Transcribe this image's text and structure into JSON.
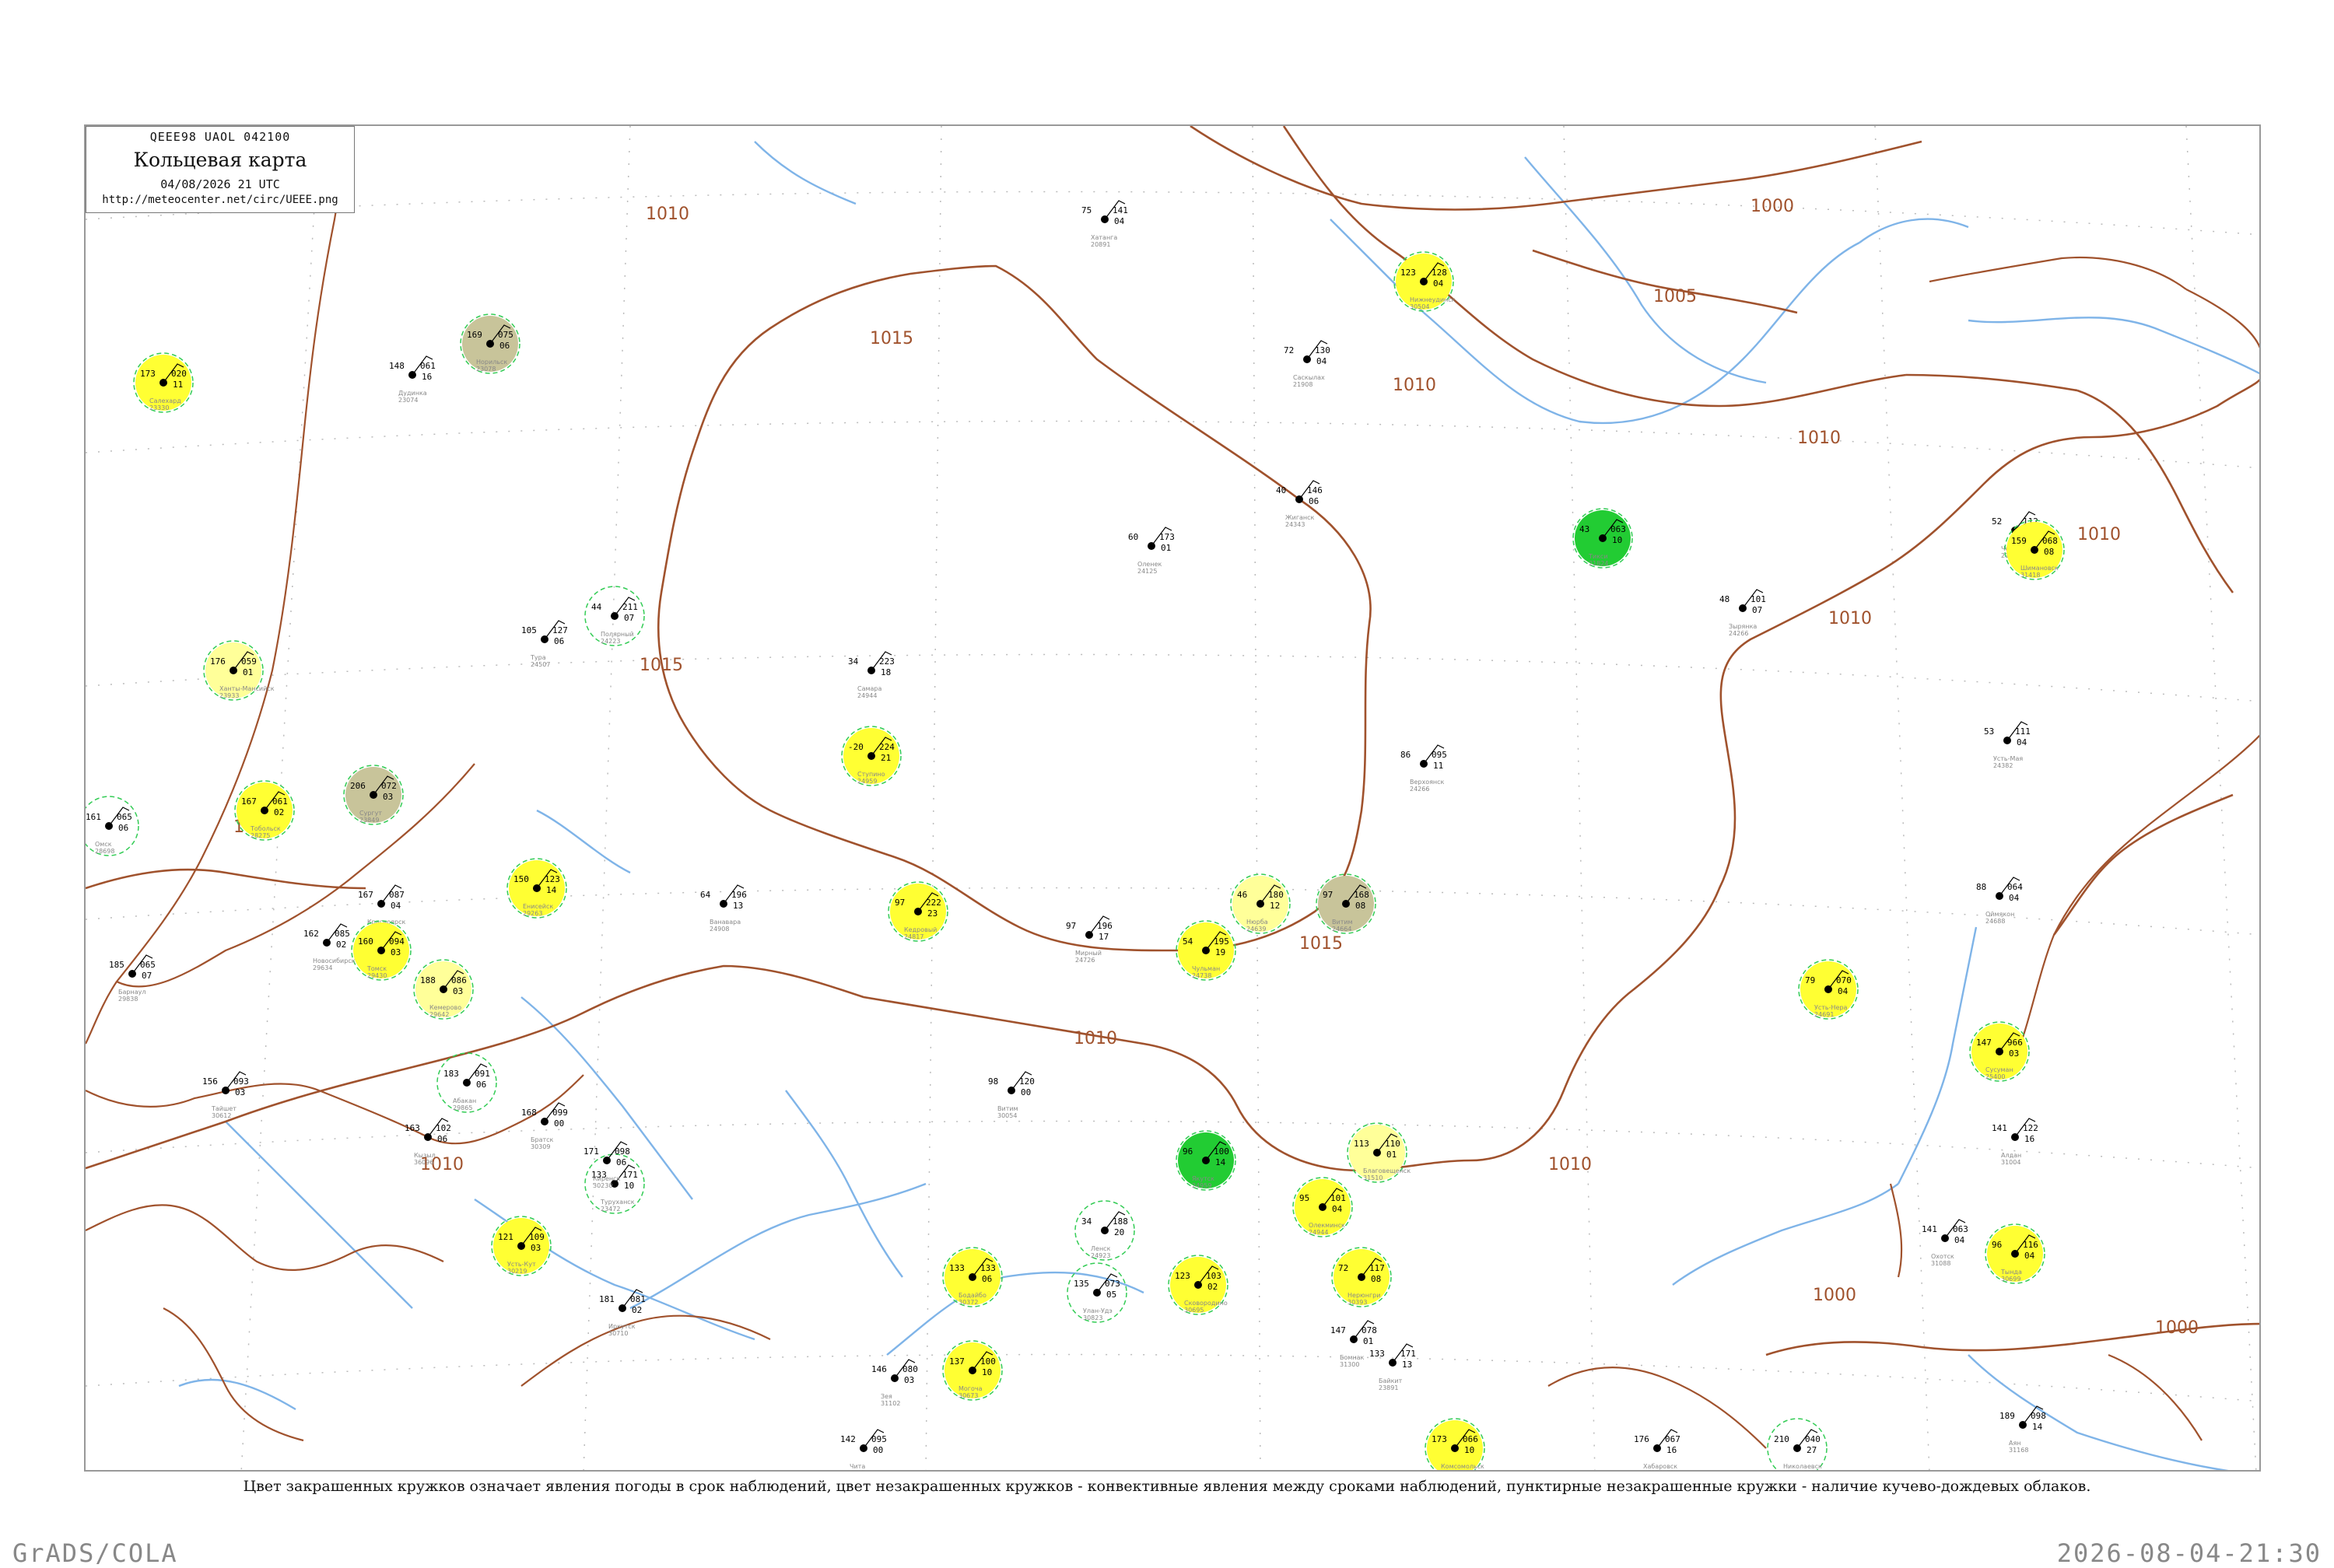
{
  "header": {
    "code": "QEEE98  UAOL  042100",
    "title": "Кольцевая карта",
    "date": "04/08/2026 21 UTC",
    "url": "http://meteocenter.net/circ/UEEE.png"
  },
  "caption": "Цвет закрашенных кружков означает явления погоды в срок наблюдений, цвет незакрашенных кружков - конвективные явления между сроками наблюдений, пунктирные незакрашенные кружки - наличие кучево-дождевых облаков.",
  "footer": {
    "left": "GrADS/COLA",
    "right": "2026-08-04-21:30"
  },
  "colors": {
    "isobar": "#a0522d",
    "river": "#7fb4e8",
    "fill_yellow": "#ffff33",
    "fill_light_yellow": "#ffff99",
    "fill_olive": "#c8c49a",
    "fill_green": "#22cc33",
    "fill_red": "#ee3366",
    "ring_green": "#33cc55",
    "ring_pink": "#ee4488"
  },
  "isobars": [
    "1000",
    "1005",
    "1010",
    "1015"
  ],
  "stations": [
    {
      "name": "Самара",
      "id": "24944",
      "t": "223",
      "p": "18",
      "td": "34",
      "fill": "none"
    },
    {
      "name": "Ступино",
      "id": "24959",
      "t": "224",
      "p": "21",
      "td": "-20",
      "fill": "yellow"
    },
    {
      "name": "Кедровый",
      "id": "24817",
      "t": "222",
      "p": "23",
      "td": "97",
      "fill": "yellow"
    },
    {
      "name": "Чульман",
      "id": "24738",
      "t": "195",
      "p": "19",
      "td": "54",
      "fill": "yellow"
    },
    {
      "name": "Мирный",
      "id": "24726",
      "t": "196",
      "p": "17",
      "td": "97",
      "fill": "none"
    },
    {
      "name": "Нюрба",
      "id": "24639",
      "t": "180",
      "p": "12",
      "td": "46",
      "fill": "light_yellow"
    },
    {
      "name": "Витим",
      "id": "24664",
      "t": "168",
      "p": "08",
      "td": "97",
      "fill": "olive"
    },
    {
      "name": "Тикси",
      "id": "21824",
      "t": "063",
      "p": "10",
      "td": "43",
      "fill": "green"
    },
    {
      "name": "Чокурдах",
      "id": "21946",
      "t": "112",
      "p": "02",
      "td": "52",
      "fill": "none"
    },
    {
      "name": "Зырянка",
      "id": "24266",
      "t": "101",
      "p": "07",
      "td": "48",
      "fill": "none"
    },
    {
      "name": "Усть-Мая",
      "id": "24382",
      "t": "111",
      "p": "04",
      "td": "53",
      "fill": "none"
    },
    {
      "name": "Оймякон",
      "id": "24688",
      "t": "064",
      "p": "04",
      "td": "88",
      "fill": "none"
    },
    {
      "name": "Усть-Нера",
      "id": "24691",
      "t": "070",
      "p": "04",
      "td": "79",
      "fill": "yellow"
    },
    {
      "name": "Сусуман",
      "id": "25400",
      "t": "966",
      "p": "03",
      "td": "147",
      "fill": "yellow"
    },
    {
      "name": "Алдан",
      "id": "31004",
      "t": "122",
      "p": "16",
      "td": "141",
      "fill": "none"
    },
    {
      "name": "Якутск",
      "id": "24959",
      "t": "100",
      "p": "14",
      "td": "96",
      "fill": "green"
    },
    {
      "name": "Олекминск",
      "id": "24944",
      "t": "101",
      "p": "04",
      "td": "95",
      "fill": "yellow"
    },
    {
      "name": "Ленск",
      "id": "24923",
      "t": "188",
      "p": "20",
      "td": "34",
      "fill": "none"
    },
    {
      "name": "Витим",
      "id": "30054",
      "t": "120",
      "p": "00",
      "td": "98",
      "fill": "none"
    },
    {
      "name": "Бодайбо",
      "id": "30372",
      "t": "133",
      "p": "06",
      "td": "133",
      "fill": "yellow"
    },
    {
      "name": "Чита",
      "id": "30758",
      "t": "095",
      "p": "00",
      "td": "142",
      "fill": "none"
    },
    {
      "name": "Могоча",
      "id": "30673",
      "t": "100",
      "p": "10",
      "td": "137",
      "fill": "yellow"
    },
    {
      "name": "Улан-Удэ",
      "id": "30823",
      "t": "073",
      "p": "05",
      "td": "135",
      "fill": "none"
    },
    {
      "name": "Иркутск",
      "id": "30710",
      "t": "081",
      "p": "02",
      "td": "181",
      "fill": "none"
    },
    {
      "name": "Братск",
      "id": "30309",
      "t": "099",
      "p": "00",
      "td": "168",
      "fill": "none"
    },
    {
      "name": "Красноярск",
      "id": "29574",
      "t": "087",
      "p": "04",
      "td": "167",
      "fill": "none"
    },
    {
      "name": "Енисейск",
      "id": "29263",
      "t": "123",
      "p": "14",
      "td": "150",
      "fill": "yellow"
    },
    {
      "name": "Туруханск",
      "id": "23472",
      "t": "171",
      "p": "10",
      "td": "133",
      "fill": "none"
    },
    {
      "name": "Дудинка",
      "id": "23074",
      "t": "061",
      "p": "16",
      "td": "148",
      "fill": "none"
    },
    {
      "name": "Хатанга",
      "id": "20891",
      "t": "141",
      "p": "04",
      "td": "75",
      "fill": "none"
    },
    {
      "name": "Тура",
      "id": "24507",
      "t": "127",
      "p": "06",
      "td": "105",
      "fill": "none"
    },
    {
      "name": "Ванавара",
      "id": "24908",
      "t": "196",
      "p": "13",
      "td": "64",
      "fill": "none"
    },
    {
      "name": "Норильск",
      "id": "23078",
      "t": "075",
      "p": "06",
      "td": "169",
      "fill": "olive"
    },
    {
      "name": "Салехард",
      "id": "23330",
      "t": "020",
      "p": "11",
      "td": "173",
      "fill": "yellow"
    },
    {
      "name": "Ханты-Мансийск",
      "id": "23933",
      "t": "059",
      "p": "01",
      "td": "176",
      "fill": "light_yellow"
    },
    {
      "name": "Сургут",
      "id": "23849",
      "t": "072",
      "p": "03",
      "td": "206",
      "fill": "olive"
    },
    {
      "name": "Тобольск",
      "id": "28275",
      "t": "061",
      "p": "02",
      "td": "167",
      "fill": "yellow"
    },
    {
      "name": "Омск",
      "id": "28698",
      "t": "065",
      "p": "06",
      "td": "161",
      "fill": "none"
    },
    {
      "name": "Томск",
      "id": "29430",
      "t": "094",
      "p": "03",
      "td": "160",
      "fill": "yellow"
    },
    {
      "name": "Новосибирск",
      "id": "29634",
      "t": "085",
      "p": "02",
      "td": "162",
      "fill": "none"
    },
    {
      "name": "Барнаул",
      "id": "29838",
      "t": "065",
      "p": "07",
      "td": "185",
      "fill": "none"
    },
    {
      "name": "Кемерово",
      "id": "29642",
      "t": "086",
      "p": "03",
      "td": "188",
      "fill": "light_yellow"
    },
    {
      "name": "Абакан",
      "id": "29865",
      "t": "091",
      "p": "06",
      "td": "183",
      "fill": "none"
    },
    {
      "name": "Кызыл",
      "id": "36096",
      "t": "102",
      "p": "06",
      "td": "163",
      "fill": "none"
    },
    {
      "name": "Киренск",
      "id": "30230",
      "t": "098",
      "p": "06",
      "td": "171",
      "fill": "none"
    },
    {
      "name": "Усть-Кут",
      "id": "30219",
      "t": "109",
      "p": "03",
      "td": "121",
      "fill": "yellow"
    },
    {
      "name": "Тайшет",
      "id": "30612",
      "t": "093",
      "p": "03",
      "td": "156",
      "fill": "none"
    },
    {
      "name": "Нижнеудинск",
      "id": "30504",
      "t": "128",
      "p": "04",
      "td": "123",
      "fill": "yellow"
    },
    {
      "name": "Верхоянск",
      "id": "24266",
      "t": "095",
      "p": "11",
      "td": "86",
      "fill": "none"
    },
    {
      "name": "Жиганск",
      "id": "24343",
      "t": "146",
      "p": "06",
      "td": "40",
      "fill": "none"
    },
    {
      "name": "Саскылах",
      "id": "21908",
      "t": "130",
      "p": "04",
      "td": "72",
      "fill": "none"
    },
    {
      "name": "Оленек",
      "id": "24125",
      "t": "173",
      "p": "01",
      "td": "60",
      "fill": "none"
    },
    {
      "name": "Полярный",
      "id": "24223",
      "t": "211",
      "p": "07",
      "td": "44",
      "fill": "none"
    },
    {
      "name": "Байкит",
      "id": "23891",
      "t": "171",
      "p": "13",
      "td": "133",
      "fill": "none"
    },
    {
      "name": "Бомнак",
      "id": "31300",
      "t": "078",
      "p": "01",
      "td": "147",
      "fill": "none"
    },
    {
      "name": "Зея",
      "id": "31102",
      "t": "080",
      "p": "03",
      "td": "146",
      "fill": "none"
    },
    {
      "name": "Сковородино",
      "id": "30695",
      "t": "103",
      "p": "02",
      "td": "123",
      "fill": "yellow"
    },
    {
      "name": "Благовещенск",
      "id": "31510",
      "t": "110",
      "p": "01",
      "td": "113",
      "fill": "light_yellow"
    },
    {
      "name": "Нерюнгри",
      "id": "30393",
      "t": "117",
      "p": "08",
      "td": "72",
      "fill": "yellow"
    },
    {
      "name": "Тында",
      "id": "30699",
      "t": "116",
      "p": "04",
      "td": "96",
      "fill": "yellow"
    },
    {
      "name": "Охотск",
      "id": "31088",
      "t": "063",
      "p": "04",
      "td": "141",
      "fill": "none"
    },
    {
      "name": "Аян",
      "id": "31168",
      "t": "098",
      "p": "14",
      "td": "189",
      "fill": "none"
    },
    {
      "name": "Николаевск",
      "id": "31369",
      "t": "040",
      "p": "27",
      "td": "210",
      "fill": "none"
    },
    {
      "name": "Хабаровск",
      "id": "31735",
      "t": "067",
      "p": "16",
      "td": "176",
      "fill": "none"
    },
    {
      "name": "Комсомольск",
      "id": "31532",
      "t": "066",
      "p": "10",
      "td": "173",
      "fill": "yellow"
    },
    {
      "name": "Шимановск",
      "id": "31418",
      "t": "068",
      "p": "08",
      "td": "159",
      "fill": "yellow"
    }
  ]
}
